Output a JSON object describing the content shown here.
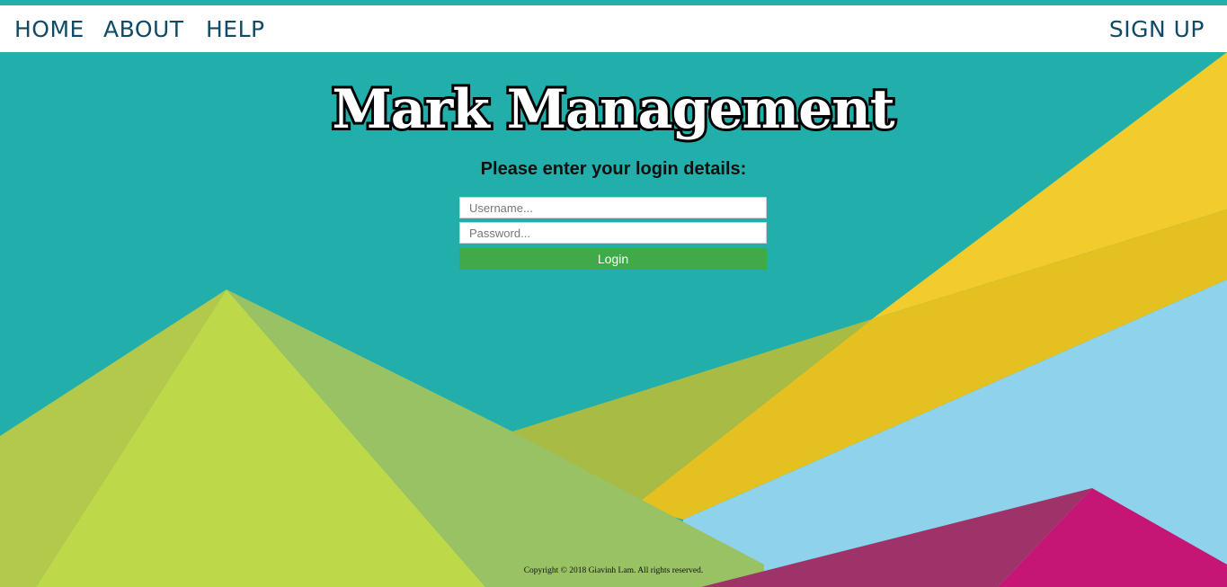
{
  "nav": {
    "home": "HOME",
    "about": "ABOUT",
    "help": "HELP",
    "signup": "SIGN UP"
  },
  "logo": {
    "text": "Mark Management"
  },
  "login": {
    "prompt": "Please enter your login details:",
    "username_placeholder": "Username...",
    "password_placeholder": "Password...",
    "button": "Login"
  },
  "footer": {
    "copyright": "Copyright © 2018 Giavinh Lam. All rights reserved."
  },
  "colors": {
    "teal": "#22afab",
    "nav_text": "#0f4b67",
    "login_button": "#3faa47",
    "yellow": "#f2cb2c",
    "lime": "#bdd848",
    "sky": "#8fd2ec",
    "magenta": "#c51675"
  }
}
